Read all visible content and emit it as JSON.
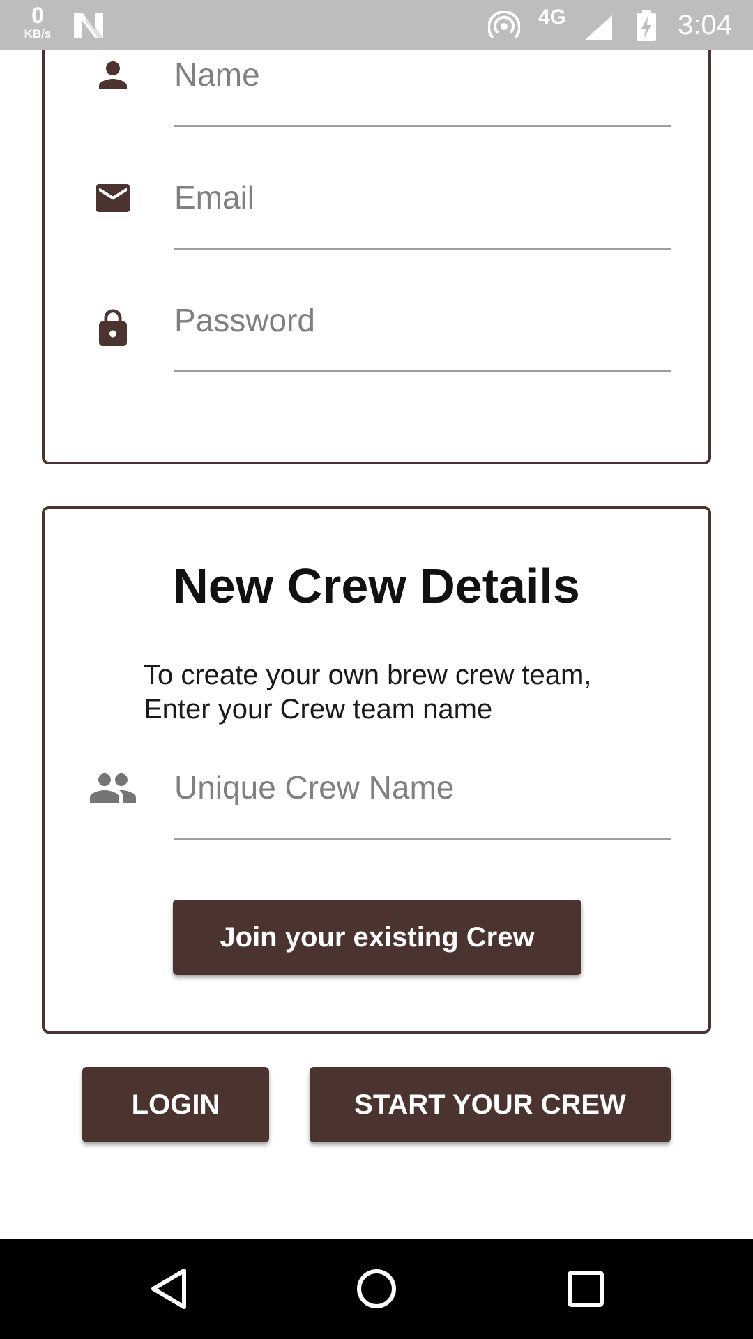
{
  "status_bar": {
    "speed_value": "0",
    "speed_unit": "KB/s",
    "network": "4G",
    "time": "3:04"
  },
  "signup_form": {
    "name": {
      "placeholder": "Name",
      "value": "",
      "icon": "person-icon"
    },
    "email": {
      "placeholder": "Email",
      "value": "",
      "icon": "mail-icon"
    },
    "password": {
      "placeholder": "Password",
      "value": "",
      "icon": "lock-icon"
    }
  },
  "crew_card": {
    "title": "New Crew Details",
    "description_line1": "To create your own brew crew team,",
    "description_line2": "Enter your Crew team name",
    "crew_name": {
      "placeholder": "Unique Crew Name",
      "value": "",
      "icon": "group-icon"
    },
    "join_button": "Join your existing Crew"
  },
  "actions": {
    "login_button": "LOGIN",
    "start_button": "START YOUR CREW"
  },
  "colors": {
    "primary": "#4b3430",
    "status_bar": "#bdbdbd",
    "nav_bar": "#000000"
  }
}
